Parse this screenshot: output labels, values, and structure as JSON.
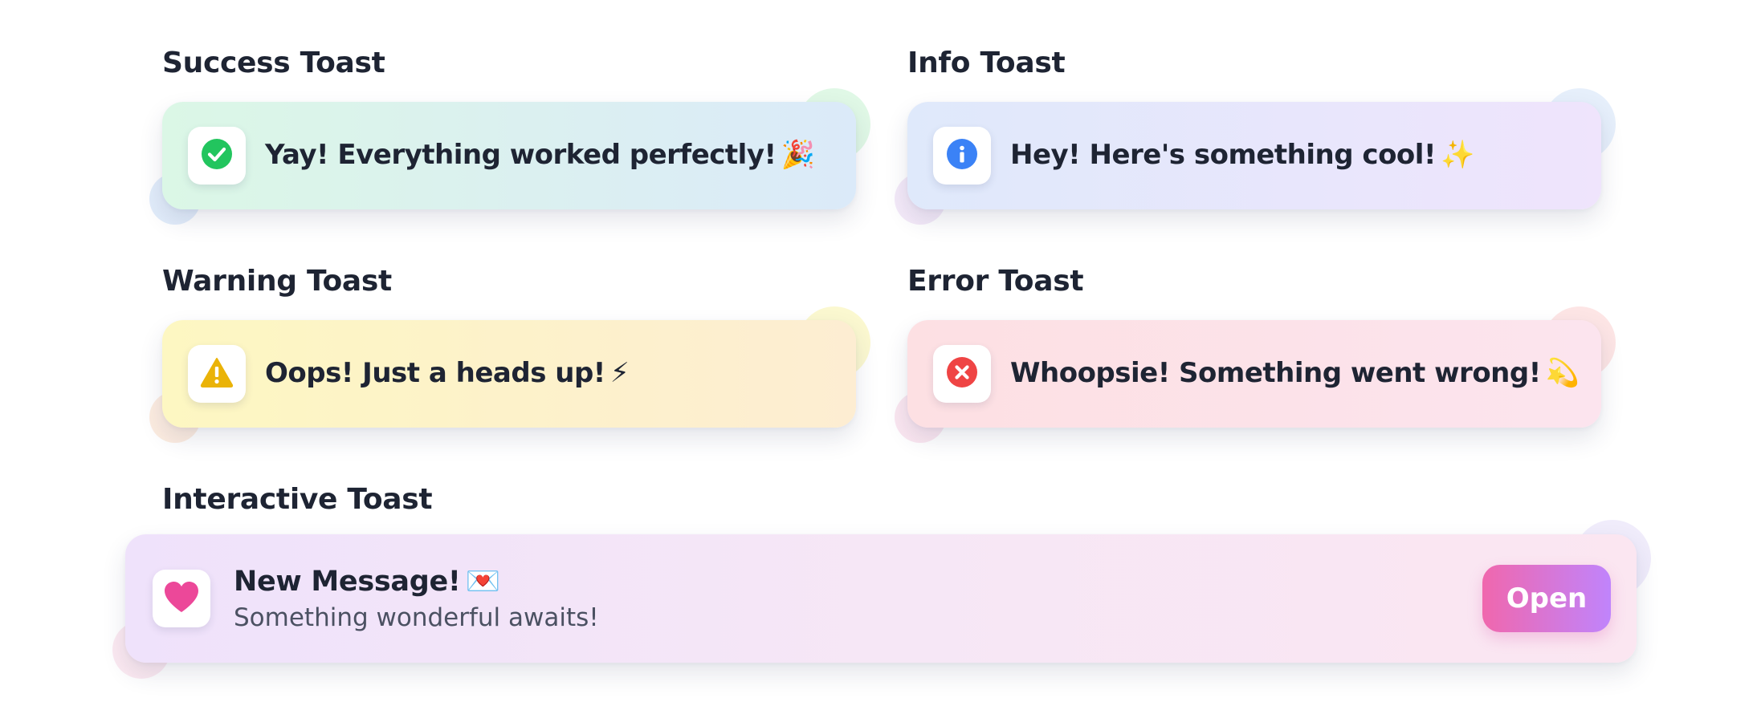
{
  "sections": {
    "success": {
      "title": "Success Toast",
      "message": "Yay! Everything worked perfectly!",
      "emoji": "🎉",
      "icon": "check-circle-icon",
      "color": "#22c55e"
    },
    "info": {
      "title": "Info Toast",
      "message": "Hey! Here's something cool!",
      "emoji": "✨",
      "icon": "info-circle-icon",
      "color": "#3b82f6"
    },
    "warning": {
      "title": "Warning Toast",
      "message": "Oops! Just a heads up!",
      "emoji": "⚡",
      "icon": "warning-triangle-icon",
      "color": "#eab308"
    },
    "error": {
      "title": "Error Toast",
      "message": "Whoopsie! Something went wrong!",
      "emoji": "💫",
      "icon": "x-circle-icon",
      "color": "#ef4444"
    },
    "interactive": {
      "title": "Interactive Toast",
      "message_title": "New Message!",
      "emoji": "💌",
      "message_body": "Something wonderful awaits!",
      "button_label": "Open",
      "icon": "heart-icon",
      "color": "#ec4899"
    }
  }
}
